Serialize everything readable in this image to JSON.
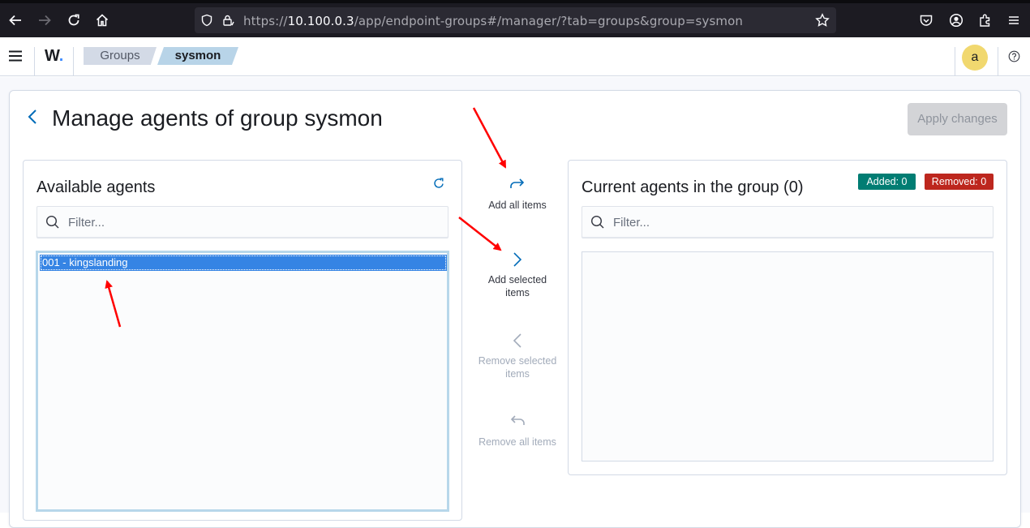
{
  "browser": {
    "url_prefix": "https://",
    "url_host": "10.100.0.3",
    "url_path": "/app/endpoint-groups#/manager/?tab=groups&group=sysmon"
  },
  "header": {
    "logo": "W",
    "breadcrumbs": [
      "Groups",
      "sysmon"
    ],
    "avatar_initial": "a"
  },
  "page": {
    "title": "Manage agents of group sysmon",
    "apply_button": "Apply changes"
  },
  "available": {
    "title": "Available agents",
    "filter_placeholder": "Filter...",
    "items": [
      "001 - kingslanding"
    ]
  },
  "current": {
    "title": "Current agents in the group (0)",
    "filter_placeholder": "Filter...",
    "badges": {
      "added": "Added: 0",
      "removed": "Removed: 0"
    }
  },
  "actions": {
    "add_all": "Add all items",
    "add_selected": "Add selected items",
    "remove_selected": "Remove selected items",
    "remove_all": "Remove all items"
  },
  "colors": {
    "accent": "#006bb8",
    "added_badge": "#017d73",
    "removed_badge": "#bd271e",
    "selection": "#3584e4",
    "annotation_arrow": "#ff0000"
  }
}
